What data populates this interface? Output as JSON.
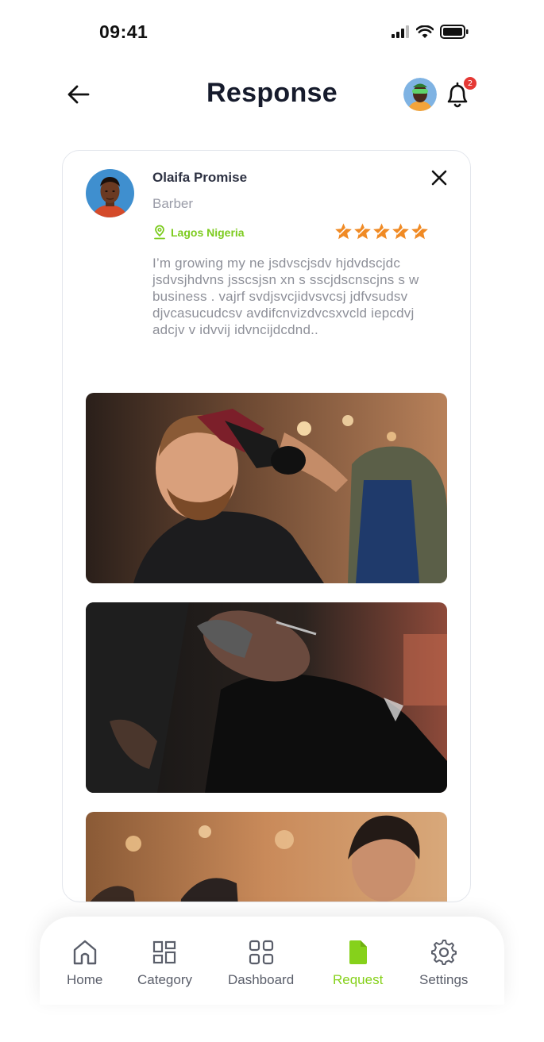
{
  "status_bar": {
    "time": "09:41"
  },
  "header": {
    "title": "Response",
    "notification_count": "2"
  },
  "profile": {
    "name": "Olaifa Promise",
    "role": "Barber",
    "location": "Lagos Nigeria",
    "rating": 5,
    "bio": "I’m growing my ne jsdvscjsdv hjdvdscjdc jsdvsjhdvns jsscsjsn xn s sscjdscnscjns s w business . vajrf svdjsvcjidvsvcsj jdfvsudsv djvcasucudcsv avdifcnvizdvcsxvcld iepcdvj adcjv v idvvij idvncijdcdnd.."
  },
  "colors": {
    "accent_green": "#86d11b",
    "star_orange": "#f08a24",
    "badge_red": "#e53935"
  },
  "nav": {
    "items": [
      {
        "label": "Home",
        "icon": "home-icon"
      },
      {
        "label": "Category",
        "icon": "category-icon"
      },
      {
        "label": "Dashboard",
        "icon": "dashboard-icon"
      },
      {
        "label": "Request",
        "icon": "request-icon",
        "active": true
      },
      {
        "label": "Settings",
        "icon": "settings-icon"
      }
    ]
  }
}
